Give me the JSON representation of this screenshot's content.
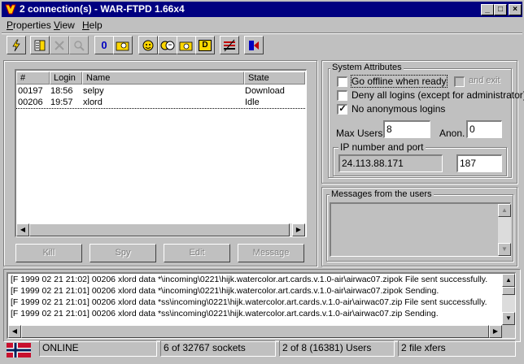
{
  "window": {
    "title": "2 connection(s) - WAR-FTPD 1.66x4",
    "controls": [
      "minimize",
      "maximize",
      "close"
    ]
  },
  "menu": [
    "Properties",
    "View",
    "Help"
  ],
  "toolbar": [
    {
      "icon": "lightning-icon"
    },
    {
      "icon": "users-list-icon"
    },
    {
      "icon": "kick-icon"
    },
    {
      "icon": "search-user-icon"
    },
    {
      "icon": "zero-icon",
      "text": "0"
    },
    {
      "icon": "folder-user-icon"
    },
    {
      "icon": "face-icon"
    },
    {
      "icon": "faces-icon"
    },
    {
      "icon": "folder-face-icon"
    },
    {
      "icon": "d-icon",
      "text": "D"
    },
    {
      "icon": "flag-striped-icon"
    },
    {
      "icon": "exit-door-icon"
    }
  ],
  "connections": {
    "columns": [
      "#",
      "Login",
      "Name",
      "State"
    ],
    "rows": [
      {
        "id": "00197",
        "login": "18:56",
        "name": "selpy",
        "state": "Download"
      },
      {
        "id": "00206",
        "login": "19:57",
        "name": "xlord",
        "state": "Idle"
      }
    ],
    "buttons": {
      "kill": "Kill",
      "spy": "Spy",
      "edit": "Edit",
      "message": "Message"
    }
  },
  "system": {
    "title": "System Attributes",
    "go_offline": "Go offline when ready",
    "and_exit": "and exit",
    "deny_all": "Deny all logins (except for administrator)",
    "no_anon": "No anonymous logins",
    "max_users_label": "Max Users",
    "max_users": "8",
    "anon_label": "Anon.",
    "anon": "0",
    "ip_title": "IP number and port",
    "ip": "24.113.88.171",
    "port": "187",
    "go_offline_checked": false,
    "deny_all_checked": false,
    "no_anon_checked": true
  },
  "messages": {
    "title": "Messages from the users"
  },
  "log": [
    "[F 1999 02 21 21:02] 00206 xlord  data *\\incoming\\0221\\hijk.watercolor.art.cards.v.1.0-air\\airwac07.zipok File sent successfully.",
    "[F 1999 02 21 21:01] 00206 xlord  data *\\incoming\\0221\\hijk.watercolor.art.cards.v.1.0-air\\airwac07.zipok Sending.",
    "[F 1999 02 21 21:01] 00206 xlord  data *ss\\incoming\\0221\\hijk.watercolor.art.cards.v.1.0-air\\airwac07.zip File sent successfully.",
    "[F 1999 02 21 21:01] 00206 xlord  data *ss\\incoming\\0221\\hijk.watercolor.art.cards.v.1.0-air\\airwac07.zip Sending."
  ],
  "status": {
    "online": "ONLINE",
    "sockets": "6 of 32767 sockets",
    "users": "2 of 8 (16381) Users",
    "xfers": "2 file xfers"
  },
  "colors": {
    "titlebar": "#000080",
    "face": "#c0c0c0",
    "flag_red": "#c8102e",
    "flag_blue": "#00205b"
  }
}
